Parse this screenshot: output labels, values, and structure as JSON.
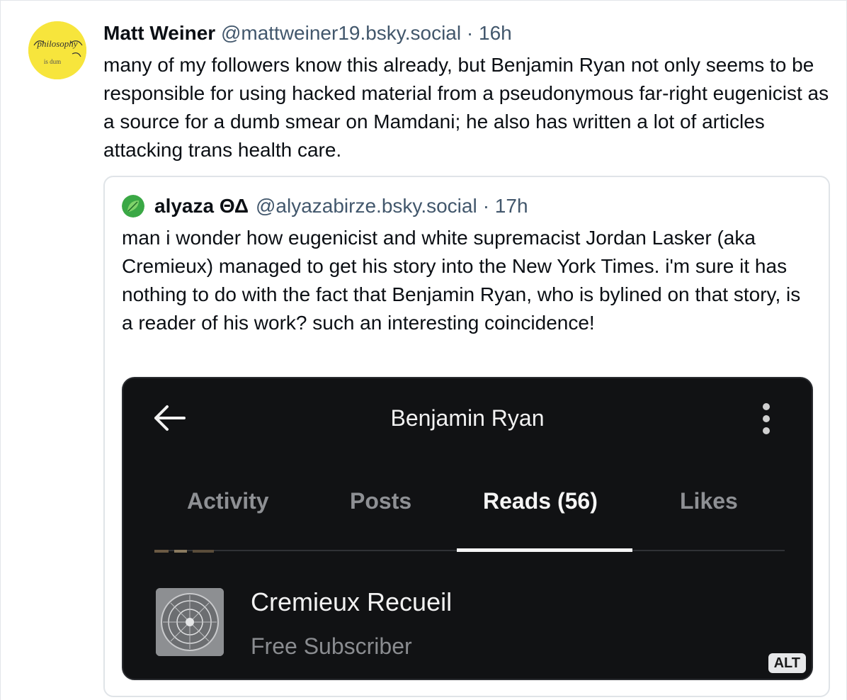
{
  "post": {
    "author": "Matt Weiner",
    "handle": "@mattweiner19.bsky.social",
    "time": "· 16h",
    "avatar_icon": "philosophy-is-dum-avatar",
    "avatar_text_top": "philosophy",
    "avatar_text_bottom": "is dum",
    "body": "many of my followers know this already, but Benjamin Ryan not only seems to be responsible for using hacked material from a pseudonymous far-right eugenicist as a source for a dumb smear on Mamdani; he also has written a lot of articles attacking trans health care."
  },
  "quote": {
    "author": "alyaza ΘΔ",
    "handle": "@alyazabirze.bsky.social",
    "time": "· 17h",
    "avatar_icon": "green-leaf-avatar",
    "body": "man i wonder how eugenicist and white supremacist Jordan Lasker (aka Cremieux) managed to get his story into the New York Times. i'm sure it has nothing to do with the fact that Benjamin Ryan, who is bylined on that story, is a reader of his work? such an interesting coincidence!"
  },
  "embed": {
    "title": "Benjamin Ryan",
    "tabs": [
      "Activity",
      "Posts",
      "Reads (56)",
      "Likes"
    ],
    "active_tab": "Reads (56)",
    "subscription_name": "Cremieux Recueil",
    "subscription_status": "Free Subscriber",
    "alt_label": "ALT"
  },
  "colors": {
    "avatar_yellow": "#f7e53c",
    "handle_gray": "#42576c",
    "embed_bg": "#111214",
    "leaf_green": "#3aa845"
  }
}
